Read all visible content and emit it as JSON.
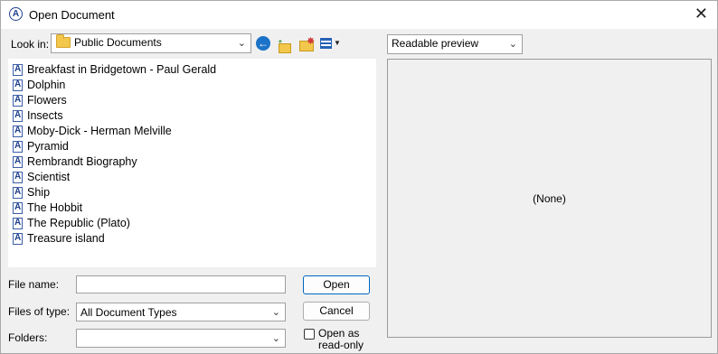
{
  "window": {
    "title": "Open Document",
    "close_glyph": "✕",
    "app_icon": "A"
  },
  "look_in": {
    "label": "Look in:",
    "value": "Public Documents"
  },
  "toolbar": {
    "back": "back-arrow-icon",
    "up": "up-folder-icon",
    "new_folder": "new-folder-icon",
    "views": "views-menu-icon"
  },
  "files": [
    "Breakfast in Bridgetown - Paul Gerald",
    "Dolphin",
    "Flowers",
    "Insects",
    "Moby-Dick - Herman Melville",
    "Pyramid",
    "Rembrandt Biography",
    "Scientist",
    "Ship",
    "The Hobbit",
    "The Republic (Plato)",
    "Treasure island"
  ],
  "file_name": {
    "label": "File name:",
    "value": ""
  },
  "files_of_type": {
    "label": "Files of type:",
    "value": "All Document Types"
  },
  "folders": {
    "label": "Folders:",
    "value": ""
  },
  "buttons": {
    "open": "Open",
    "cancel": "Cancel"
  },
  "read_only": {
    "label_line1": "Open as",
    "label_line2": "read-only",
    "checked": false
  },
  "preview": {
    "mode": "Readable preview",
    "content": "(None)"
  },
  "colors": {
    "default_button_border": "#0067c0",
    "dialog_bg": "#f0f0f0"
  }
}
